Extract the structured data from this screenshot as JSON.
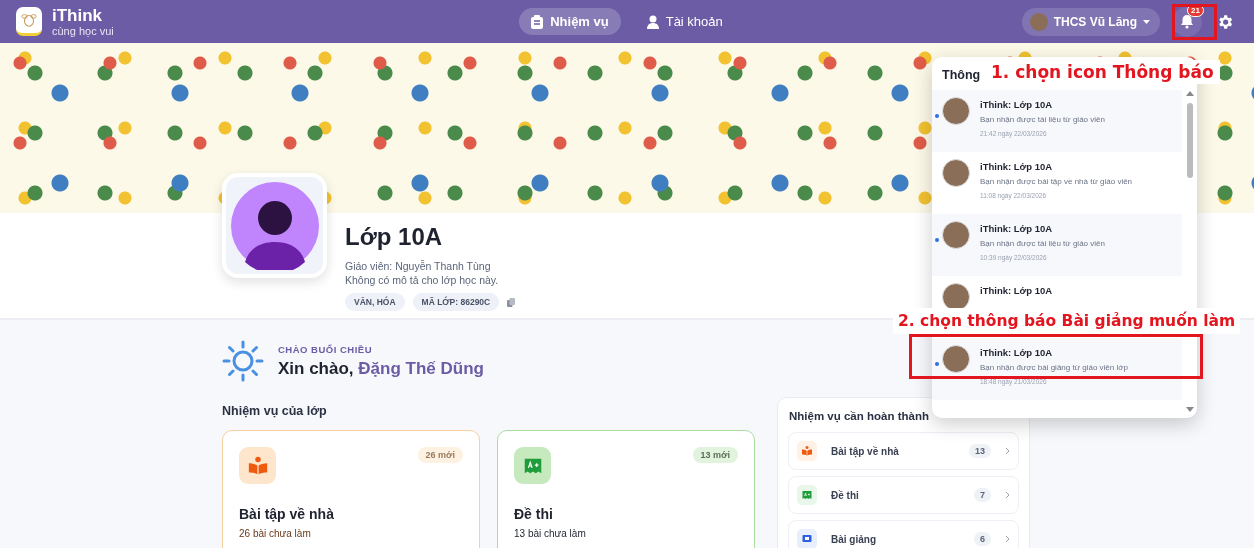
{
  "header": {
    "app_name": "iThink",
    "tagline": "cùng học vui",
    "nav": [
      {
        "label": "Nhiệm vụ",
        "selected": true
      },
      {
        "label": "Tài khoản",
        "selected": false
      }
    ],
    "school": "THCS Vũ Lăng",
    "notification_count": "21",
    "bell_highlighted": true
  },
  "class_profile": {
    "name": "Lớp 10A",
    "teacher": "Giáo viên: Nguyễn Thanh Tùng",
    "description": "Không có mô tả cho lớp học này.",
    "tags": [
      "VĂN, HÓA",
      "MÃ LỚP: 86290C"
    ]
  },
  "greeting": {
    "period": "CHÀO BUỔI CHIỀU",
    "text": "Xin chào,",
    "name": "Đặng Thế Dũng"
  },
  "class_tasks": {
    "title": "Nhiệm vụ của lớp",
    "cards": [
      {
        "kind": "homework",
        "badge": "26 mới",
        "title": "Bài tập về nhà",
        "subtitle": "26 bài chưa làm"
      },
      {
        "kind": "exam",
        "badge": "13 mới",
        "title": "Đề thi",
        "subtitle": "13 bài chưa làm"
      }
    ]
  },
  "todo_panel": {
    "title": "Nhiệm vụ cần hoàn thành",
    "items": [
      {
        "kind": "homework",
        "label": "Bài tập về nhà",
        "count": "13"
      },
      {
        "kind": "exam",
        "label": "Đề thi",
        "count": "7"
      },
      {
        "kind": "lecture",
        "label": "Bài giảng",
        "count": "6"
      }
    ]
  },
  "notifications": {
    "title": "Thông",
    "items": [
      {
        "title": "iThink: Lớp 10A",
        "message": "Bạn nhận được tài liệu từ giáo viên",
        "time": "21:42 ngày 22/03/2026",
        "unread": true,
        "highlighted": false
      },
      {
        "title": "iThink: Lớp 10A",
        "message": "Bạn nhận được bài tập về nhà từ giáo viên",
        "time": "11:08 ngày 22/03/2026",
        "unread": false,
        "highlighted": false
      },
      {
        "title": "iThink: Lớp 10A",
        "message": "Bạn nhận được tài liệu từ giáo viên",
        "time": "10:39 ngày 22/03/2026",
        "unread": true,
        "highlighted": false
      },
      {
        "title": "iThink: Lớp 10A",
        "unread": false,
        "highlighted": false
      },
      {
        "title": "iThink: Lớp 10A",
        "message": "Bạn nhận được bài giảng từ giáo viên lớp",
        "time": "18:48 ngày 21/03/2026",
        "unread": true,
        "highlighted": true
      }
    ]
  },
  "annotations": [
    "1. chọn icon Thông báo",
    "2. chọn thông báo Bài giảng muốn làm"
  ]
}
